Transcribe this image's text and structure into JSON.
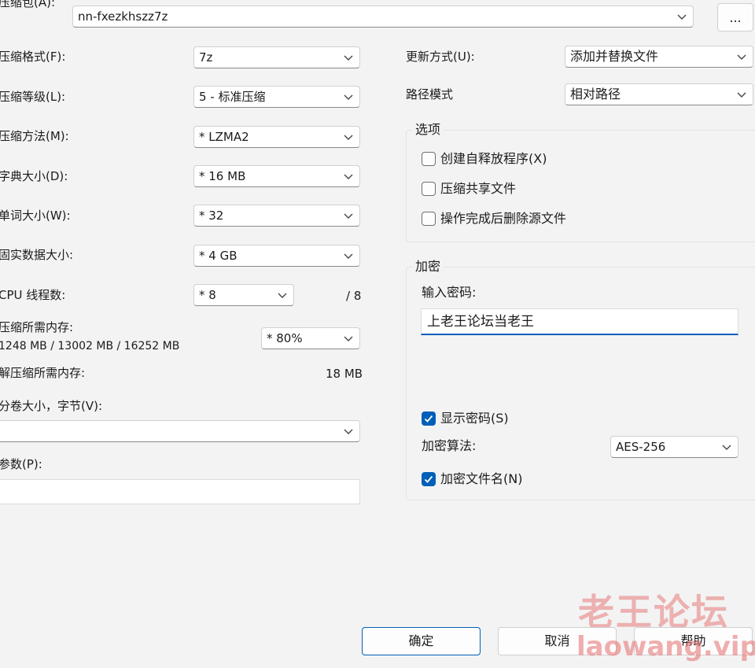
{
  "archive": {
    "label": "压缩包(A):",
    "value": "nn-fxezkhszz7z",
    "browse_label": "..."
  },
  "left": {
    "format_label": "压缩格式(F):",
    "format_value": "7z",
    "level_label": "压缩等级(L):",
    "level_value": "5 - 标准压缩",
    "method_label": "压缩方法(M):",
    "method_value": "* LZMA2",
    "dict_label": "字典大小(D):",
    "dict_value": "* 16 MB",
    "word_label": "单词大小(W):",
    "word_value": "* 32",
    "solid_label": "固实数据大小:",
    "solid_value": "* 4 GB",
    "threads_label": "CPU 线程数:",
    "threads_value": "* 8",
    "threads_max": "/ 8",
    "mem_label": "压缩所需内存:",
    "mem_detail": "1248 MB / 13002 MB / 16252 MB",
    "mem_value": "* 80%",
    "decomp_label": "解压缩所需内存:",
    "decomp_value": "18 MB",
    "split_label": "分卷大小，字节(V):",
    "split_value": "",
    "params_label": "参数(P):",
    "params_value": ""
  },
  "right": {
    "update_label": "更新方式(U):",
    "update_value": "添加并替换文件",
    "path_label": "路径模式",
    "path_value": "相对路径",
    "options": {
      "title": "选项",
      "items": [
        {
          "label": "创建自释放程序(X)",
          "checked": false
        },
        {
          "label": "压缩共享文件",
          "checked": false
        },
        {
          "label": "操作完成后删除源文件",
          "checked": false
        }
      ]
    },
    "encryption": {
      "title": "加密",
      "password_label": "输入密码:",
      "password_value": "上老王论坛当老王",
      "show_password_label": "显示密码(S)",
      "show_password_checked": true,
      "method_label": "加密算法:",
      "method_value": "AES-256",
      "encrypt_names_label": "加密文件名(N)",
      "encrypt_names_checked": true
    }
  },
  "footer": {
    "ok_label": "确定",
    "cancel_label": "取消",
    "help_label": "帮助"
  },
  "watermark": {
    "title": "老王论坛",
    "url": "laowang.vip"
  },
  "colors": {
    "accent": "#005fb8",
    "background": "#f3f3f3"
  }
}
